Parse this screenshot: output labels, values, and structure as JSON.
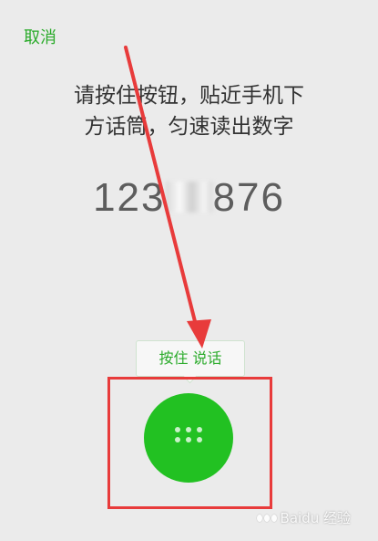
{
  "header": {
    "cancel_label": "取消"
  },
  "instruction": {
    "line1": "请按住按钮，贴近手机下",
    "line2": "方话筒，匀速读出数字"
  },
  "digits": {
    "prefix": "123",
    "suffix": "876"
  },
  "tooltip": {
    "label": "按住 说话"
  },
  "watermark": {
    "text": "Baidu 经验"
  },
  "colors": {
    "accent": "#22c122",
    "annotation": "#e83b3b"
  }
}
